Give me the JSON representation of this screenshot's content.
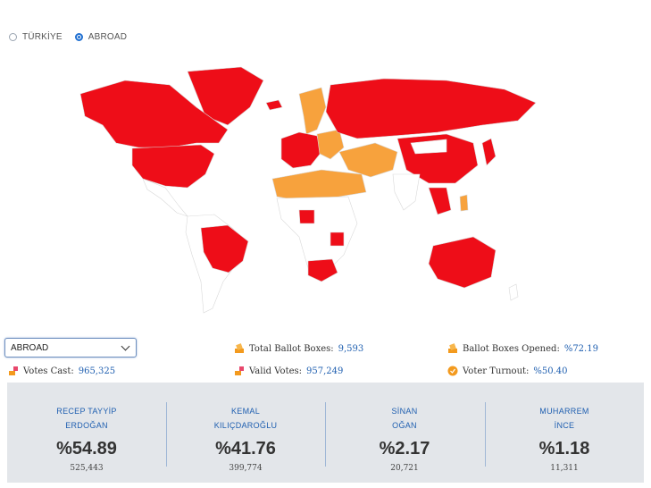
{
  "region_selector": {
    "options": [
      {
        "label": "TÜRKİYE",
        "selected": false
      },
      {
        "label": "ABROAD",
        "selected": true
      }
    ]
  },
  "map": {
    "colors": {
      "winner": "#ee0d18",
      "second": "#f7a23d",
      "no_data": "#ffffff",
      "border": "#d9d9d9"
    }
  },
  "dropdown": {
    "selected": "ABROAD"
  },
  "stats": {
    "total_ballot_boxes_label": "Total Ballot Boxes:",
    "total_ballot_boxes": "9,593",
    "ballot_boxes_opened_label": "Ballot Boxes Opened:",
    "ballot_boxes_opened": "%72.19",
    "votes_cast_label": "Votes Cast:",
    "votes_cast": "965,325",
    "valid_votes_label": "Valid Votes:",
    "valid_votes": "957,249",
    "voter_turnout_label": "Voter Turnout:",
    "voter_turnout": "%50.40"
  },
  "candidates": [
    {
      "first": "RECEP TAYYİP",
      "last": "ERDOĞAN",
      "pct": "%54.89",
      "votes": "525,443"
    },
    {
      "first": "KEMAL",
      "last": "KILIÇDAROĞLU",
      "pct": "%41.76",
      "votes": "399,774"
    },
    {
      "first": "SİNAN",
      "last": "OĞAN",
      "pct": "%2.17",
      "votes": "20,721"
    },
    {
      "first": "MUHARREM",
      "last": "İNCE",
      "pct": "%1.18",
      "votes": "11,311"
    }
  ]
}
